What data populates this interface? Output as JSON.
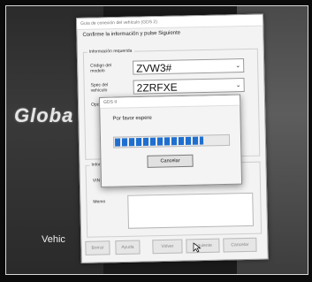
{
  "background": {
    "brand_text": "Globa",
    "vehicle_text": "Vehic"
  },
  "main_dialog": {
    "title": "Guia de conexión del vehículo (GDS 2)",
    "instruction": "Confirme la información y pulse Siguiente",
    "section_info": "Información requerida",
    "vehicle_code_label": "Código del modelo",
    "vehicle_code_value": "ZVW3#",
    "spec_label": "Spec del vehículo",
    "spec_value": "2ZRFXE",
    "option_label": "Opc",
    "section_other": "Informa",
    "vin_label": "VIN",
    "memo_label": "Memo",
    "buttons": [
      "Borrar",
      "Ayuda",
      "Volver",
      "Siguiente",
      "Cancelar"
    ]
  },
  "progress_dialog": {
    "title": "GDS II",
    "wait_text": "Por favor espere",
    "progress": 0.78,
    "cancel_label": "Cancelar"
  }
}
